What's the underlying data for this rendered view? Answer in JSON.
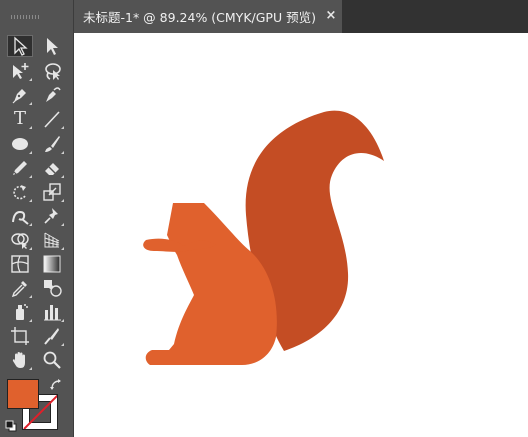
{
  "document": {
    "tab_title": "未标题-1* @ 89.24% (CMYK/GPU 预览)",
    "close_label": "×"
  },
  "tools": {
    "type_glyph": "T"
  },
  "colors": {
    "fill": "#e0612d",
    "squirrel_body": "#e0612d",
    "squirrel_tail": "#c44d24",
    "stroke": "none"
  }
}
